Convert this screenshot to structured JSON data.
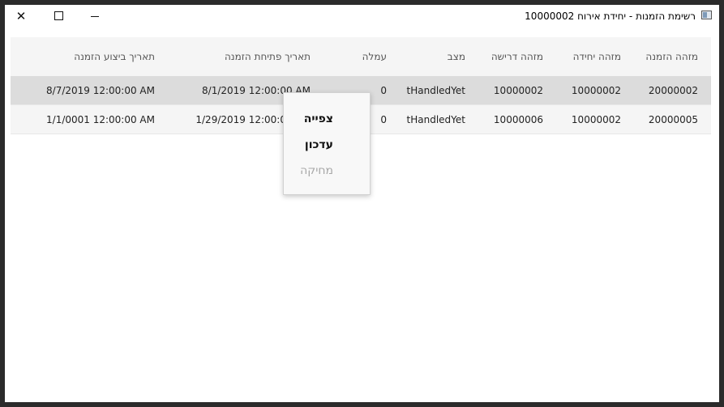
{
  "window": {
    "title": "רשימת הזמנות - יחידת אירוח 10000002"
  },
  "controls": {
    "close": "✕",
    "maximize_icon": "maximize-icon",
    "minimize_icon": "minimize-icon"
  },
  "table": {
    "columns": [
      "מזהה הזמנה",
      "מזהה יחידה",
      "מזהה דרישה",
      "מצב",
      "עמלה",
      "תאריך פתיחת הזמנה",
      "תאריך ביצוע הזמנה"
    ],
    "rows": [
      [
        "20000002",
        "10000002",
        "10000002",
        "tHandledYet",
        "0",
        "8/1/2019 12:00:00 AM",
        "8/7/2019 12:00:00 AM"
      ],
      [
        "20000005",
        "10000002",
        "10000006",
        "tHandledYet",
        "0",
        "1/29/2019 12:00:00 AM",
        "1/1/0001 12:00:00 AM"
      ]
    ]
  },
  "context_menu": {
    "items": [
      {
        "label": "צפייה",
        "enabled": true
      },
      {
        "label": "עדכון",
        "enabled": true
      },
      {
        "label": "מחיקה",
        "enabled": false
      }
    ]
  }
}
